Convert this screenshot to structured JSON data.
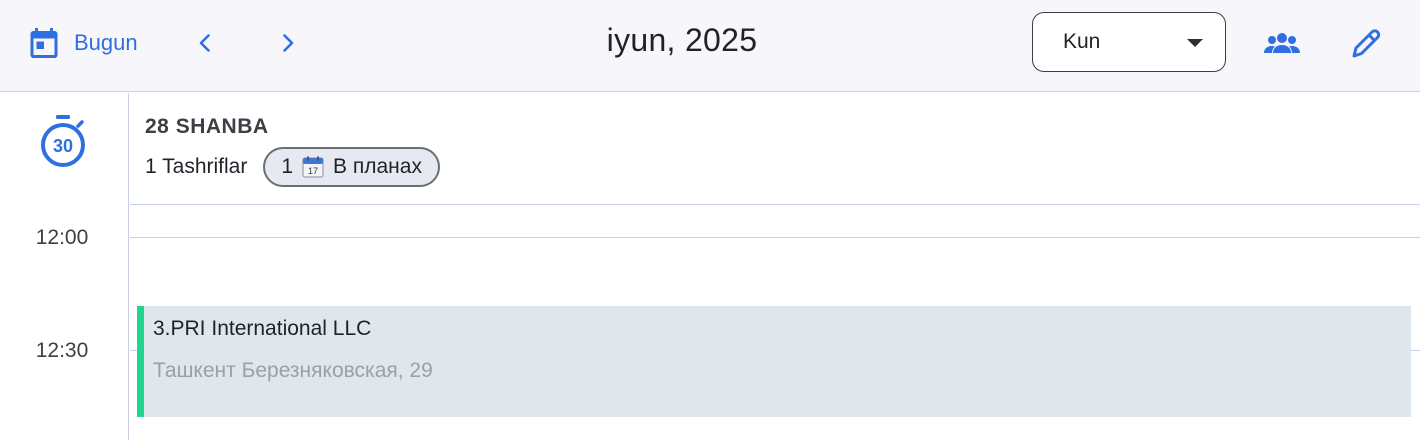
{
  "toolbar": {
    "today_label": "Bugun",
    "period_title": "iyun, 2025",
    "view_select": {
      "selected": "Kun"
    },
    "icons": {
      "today": "calendar-today-icon",
      "prev": "chevron-left-icon",
      "next": "chevron-right-icon",
      "dropdown": "caret-down-icon",
      "team": "group-icon",
      "edit": "pencil-icon"
    }
  },
  "time_gutter": {
    "timer_icon": "timer-30-icon",
    "timer_text": "30",
    "slots": [
      "12:00",
      "12:30"
    ]
  },
  "day": {
    "name": "28 SHANBA",
    "visits_label": "1 Tashriflar",
    "planned_chip": {
      "count": "1",
      "icon": "calendar-emoji-icon",
      "label": "В планах"
    }
  },
  "events": [
    {
      "title": "3.PRI International LLC",
      "address": "Ташкент  Березняковская, 29",
      "accent": "#1fd68f"
    }
  ],
  "colors": {
    "accent": "#2f6fe0",
    "toolbar_bg": "#f7f6fb",
    "grid": "#c9cfe6",
    "event_bg": "#dfe6ec",
    "event_bar": "#1fd68f"
  }
}
